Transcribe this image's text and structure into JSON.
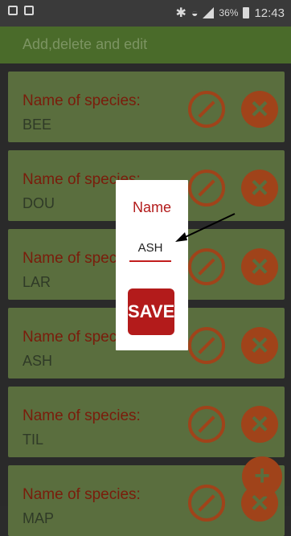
{
  "status_bar": {
    "battery_percent": "36%",
    "time": "12:43"
  },
  "app_bar": {
    "title": "Add,delete and edit"
  },
  "list": {
    "item_label": "Name of species:",
    "items": [
      {
        "value": "BEE"
      },
      {
        "value": "DOU"
      },
      {
        "value": "LAR"
      },
      {
        "value": "ASH"
      },
      {
        "value": "TIL"
      },
      {
        "value": "MAP"
      }
    ]
  },
  "dialog": {
    "title": "Name",
    "input_value": "ASH",
    "save_label": "SAVE"
  },
  "fab": {
    "icon": "plus-icon"
  },
  "colors": {
    "app_bar": "#4a6b2a",
    "card_bg": "#5a6e3e",
    "accent": "#a0431a",
    "dialog_accent": "#b31b1b"
  }
}
